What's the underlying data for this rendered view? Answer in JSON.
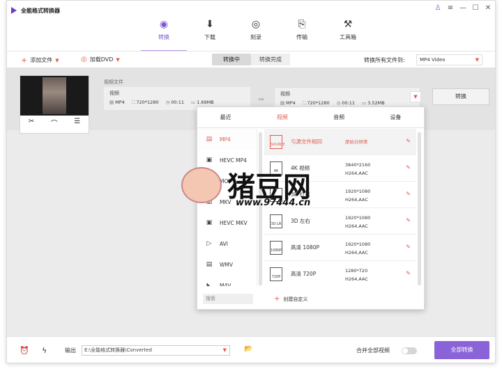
{
  "app": {
    "title": "全能格式转换器"
  },
  "window_controls": {
    "user": "♙",
    "menu": "≡",
    "minimize": "—",
    "maximize": "☐",
    "close": "✕"
  },
  "nav": [
    {
      "label": "转换",
      "icon": "convert-icon",
      "glyph": "◉",
      "active": true
    },
    {
      "label": "下载",
      "icon": "download-icon",
      "glyph": "⬇",
      "active": false
    },
    {
      "label": "刻录",
      "icon": "burn-icon",
      "glyph": "◎",
      "active": false
    },
    {
      "label": "传输",
      "icon": "transfer-icon",
      "glyph": "⎘",
      "active": false
    },
    {
      "label": "工具箱",
      "icon": "toolbox-icon",
      "glyph": "⚒",
      "active": false
    }
  ],
  "toolbar": {
    "add_file": "添加文件",
    "load_dvd": "加载DVD",
    "seg_converting": "转换中",
    "seg_done": "转换完成",
    "convert_all_to": "转换所有文件到:",
    "format_value": "MP4 Video"
  },
  "file": {
    "source_name": "视频文件",
    "source_title": "视频",
    "source": {
      "format": "MP4",
      "resolution": "720*1280",
      "duration": "00:11",
      "size": "1.69MB"
    },
    "target_title": "视频",
    "target": {
      "format": "MP4",
      "resolution": "720*1280",
      "duration": "00:11",
      "size": "3.52MB"
    },
    "convert_label": "转换",
    "tools": [
      "✂",
      "⌒",
      "☰"
    ]
  },
  "popup": {
    "tabs": [
      "最近",
      "视频",
      "音频",
      "设备"
    ],
    "active_tab": 1,
    "formats": [
      {
        "label": "MP4",
        "icon": "film-icon",
        "glyph": "▤",
        "active": true
      },
      {
        "label": "HEVC MP4",
        "icon": "hevc-icon",
        "glyph": "▣",
        "active": false
      },
      {
        "label": "MOV",
        "icon": "mov-icon",
        "glyph": "◇",
        "active": false
      },
      {
        "label": "MKV",
        "icon": "mkv-icon",
        "glyph": "▥",
        "active": false
      },
      {
        "label": "HEVC MKV",
        "icon": "hevc-mkv-icon",
        "glyph": "▣",
        "active": false
      },
      {
        "label": "AVI",
        "icon": "avi-icon",
        "glyph": "▷",
        "active": false
      },
      {
        "label": "WMV",
        "icon": "wmv-icon",
        "glyph": "▤",
        "active": false
      },
      {
        "label": "M4V",
        "icon": "m4v-icon",
        "glyph": "◣",
        "active": false
      }
    ],
    "presets": [
      {
        "name": "与源文件相同",
        "res": "原始分辨率",
        "codec": "",
        "badge": "SOURCE",
        "active": true
      },
      {
        "name": "4K 视频",
        "res": "3840*2160",
        "codec": "H264,AAC",
        "badge": "4K",
        "active": false
      },
      {
        "name": "3D 红蓝",
        "res": "1920*1080",
        "codec": "H264,AAC",
        "badge": "3D RB",
        "active": false
      },
      {
        "name": "3D 左右",
        "res": "1920*1080",
        "codec": "H264,AAC",
        "badge": "3D LR",
        "active": false
      },
      {
        "name": "高清 1080P",
        "res": "1920*1080",
        "codec": "H264,AAC",
        "badge": "1080P",
        "active": false
      },
      {
        "name": "高清 720P",
        "res": "1280*720",
        "codec": "H264,AAC",
        "badge": "720P",
        "active": false
      }
    ],
    "search_placeholder": "搜索",
    "create_custom": "创建自定义"
  },
  "watermark": {
    "text": "猪豆网",
    "url": "www.97444.cn"
  },
  "footer": {
    "output_label": "输出",
    "output_path": "E:\\全能格式转换器\\Converted",
    "merge_label": "合并全部视频",
    "convert_all_button": "全部转换"
  },
  "colors": {
    "accent": "#8a63d8",
    "highlight": "#e35b4f"
  }
}
